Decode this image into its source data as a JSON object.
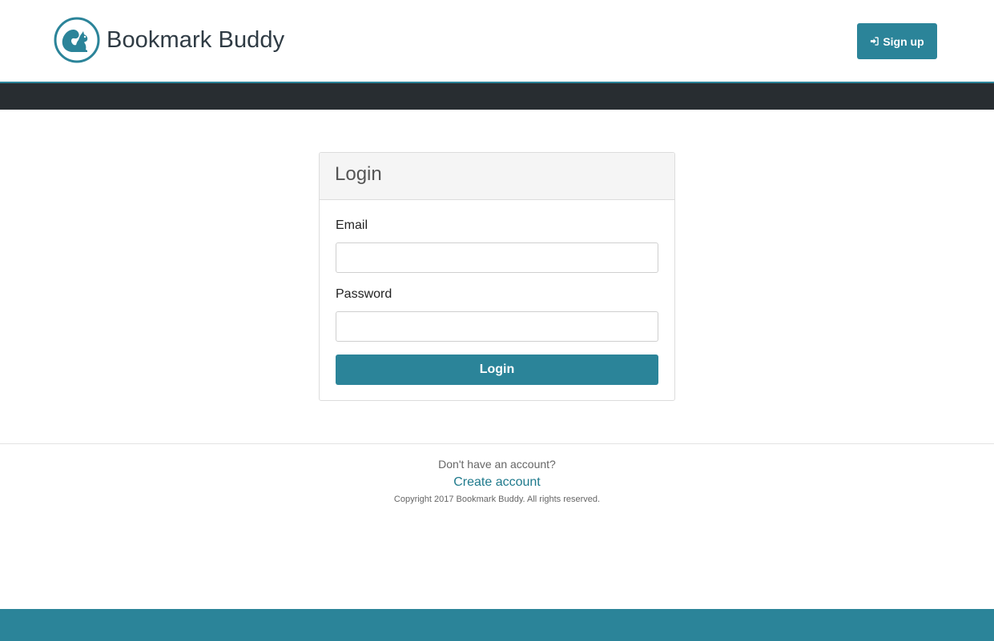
{
  "colors": {
    "accent": "#2b8499",
    "navbar": "#282d31",
    "panel_header_bg": "#f5f5f5",
    "link": "#1f7a8c"
  },
  "header": {
    "brand": "Bookmark Buddy",
    "logo_icon": "squirrel-icon",
    "signup_icon": "sign-in-icon",
    "signup_label": "Sign up"
  },
  "login_panel": {
    "title": "Login",
    "email_label": "Email",
    "email_value": "",
    "password_label": "Password",
    "password_value": "",
    "submit_label": "Login"
  },
  "footer": {
    "prompt": "Don't have an account?",
    "create_link": "Create account",
    "copyright": "Copyright 2017 Bookmark Buddy. All rights reserved."
  }
}
